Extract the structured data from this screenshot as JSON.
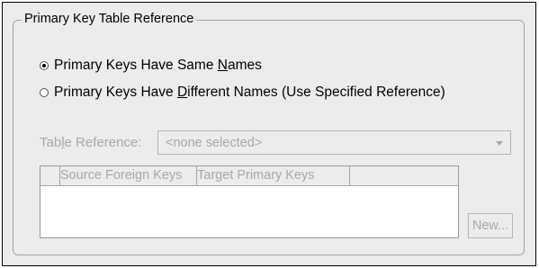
{
  "group": {
    "title": "Primary Key Table Reference"
  },
  "radios": [
    {
      "label_pre": "Primary Keys Have Same ",
      "label_mnemonic": "N",
      "label_post": "ames",
      "checked": true
    },
    {
      "label_pre": "Primary Keys Have ",
      "label_mnemonic": "D",
      "label_post": "ifferent Names (Use Specified Reference)",
      "checked": false
    }
  ],
  "table_reference": {
    "label_pre": "Tab",
    "label_mnemonic": "l",
    "label_post": "e Reference:",
    "selected_value": "<none selected>",
    "enabled": false
  },
  "key_table": {
    "columns": [
      "",
      "Source Foreign Keys",
      "Target Primary Keys",
      ""
    ],
    "rows": []
  },
  "buttons": {
    "new_label": "New..."
  }
}
